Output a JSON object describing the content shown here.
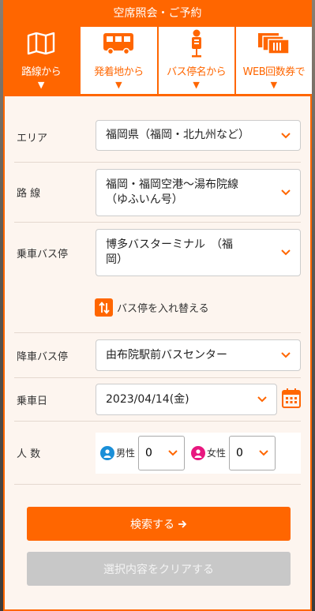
{
  "header": {
    "title": "空席照会・ご予約"
  },
  "tabs": [
    {
      "label": "路線から",
      "icon": "map-icon",
      "active": true
    },
    {
      "label": "発着地から",
      "icon": "bus-icon",
      "active": false
    },
    {
      "label": "バス停名から",
      "icon": "bus-stop-icon",
      "active": false
    },
    {
      "label": "WEB回数券で",
      "icon": "tickets-icon",
      "active": false
    }
  ],
  "tab_arrow": "▼",
  "form": {
    "area": {
      "label": "エリア",
      "value": "福岡県（福岡・北九州など）"
    },
    "route": {
      "label": "路 線",
      "value_line1": "福岡・福岡空港～湯布院線",
      "value_line2": "（ゆふいん号）"
    },
    "boarding": {
      "label": "乗車バス停",
      "value_line1": "博多バスターミナル　（福",
      "value_line2": "岡）"
    },
    "swap": {
      "label": "バス停を入れ替える"
    },
    "alighting": {
      "label": "降車バス停",
      "value": "由布院駅前バスセンター"
    },
    "date": {
      "label": "乗車日",
      "value": "2023/04/14(金)"
    },
    "people": {
      "label": "人 数",
      "male": {
        "label": "男性",
        "value": "0"
      },
      "female": {
        "label": "女性",
        "value": "0"
      }
    }
  },
  "buttons": {
    "search": "検索する",
    "clear": "選択内容をクリアする"
  },
  "colors": {
    "accent": "#ff6600",
    "male": "#1a8fd8",
    "female": "#e8177f"
  }
}
